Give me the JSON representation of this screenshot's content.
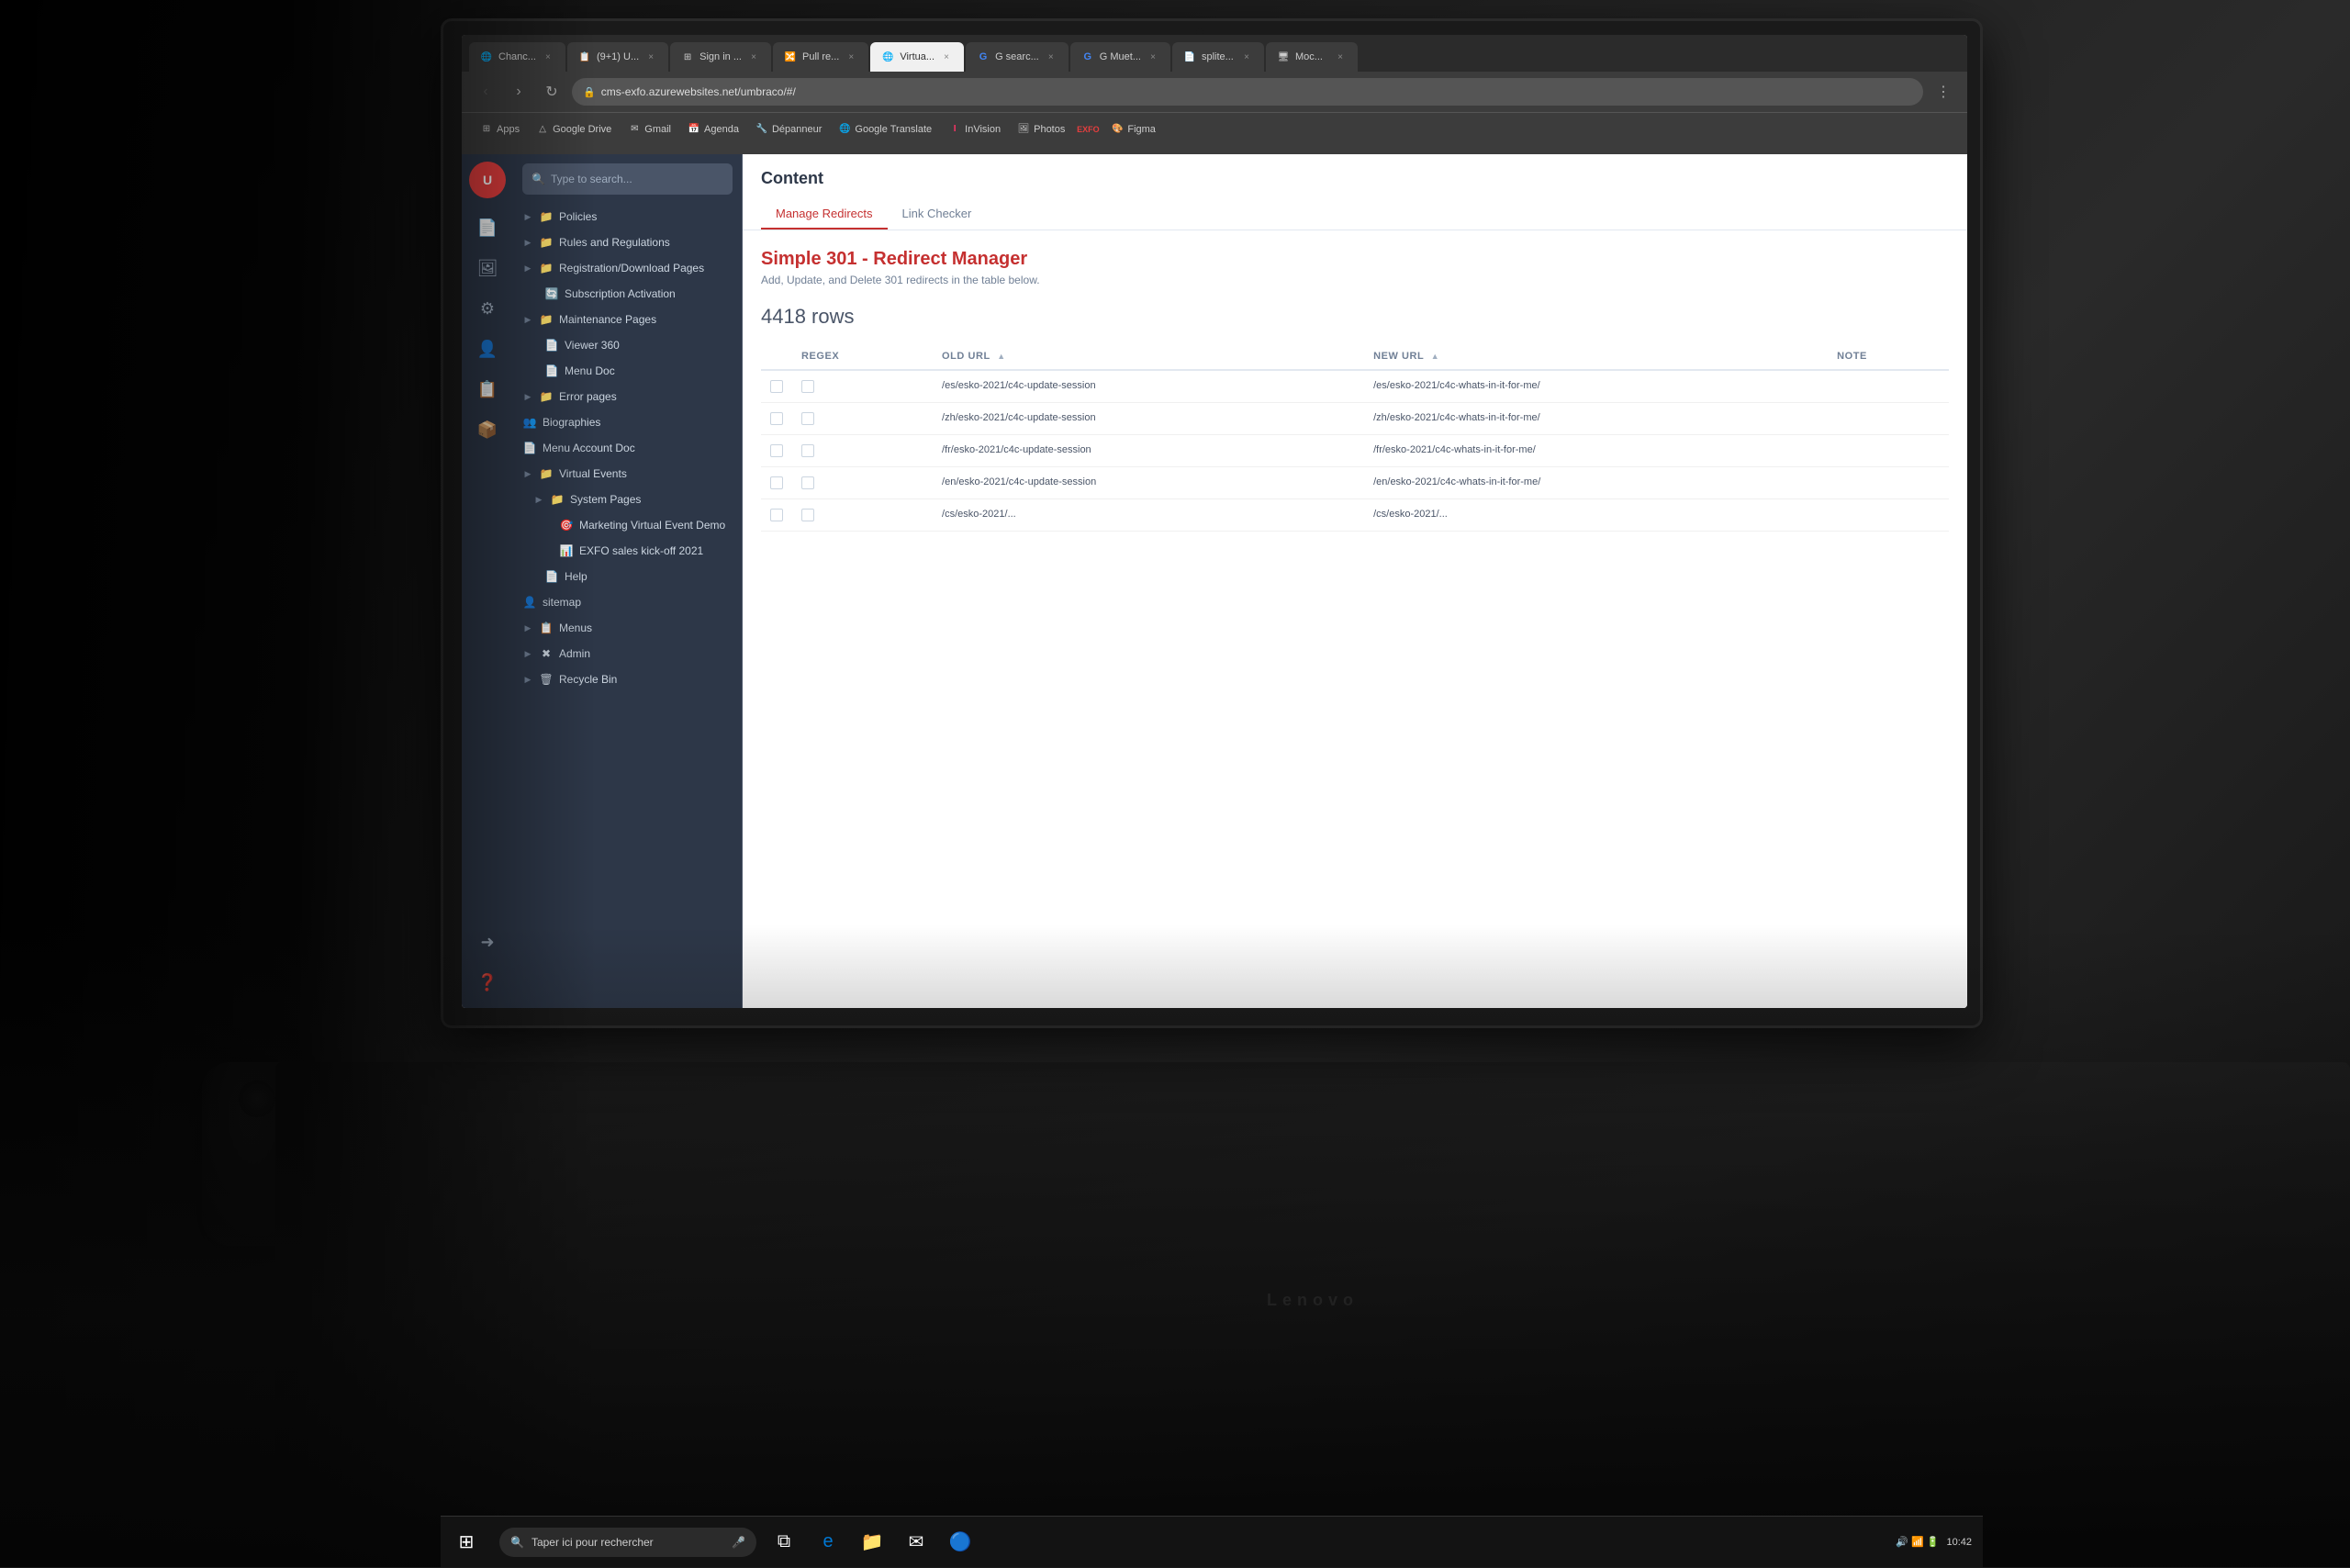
{
  "browser": {
    "tabs": [
      {
        "label": "Chanc...",
        "active": false,
        "favicon": "🌐"
      },
      {
        "label": "(9+1) U...",
        "active": false,
        "favicon": "📋"
      },
      {
        "label": "Sign in ...",
        "active": false,
        "favicon": "⊞"
      },
      {
        "label": "Pull re...",
        "active": false,
        "favicon": "🔀"
      },
      {
        "label": "Virtua...",
        "active": true,
        "favicon": "🌐"
      },
      {
        "label": "G searc...",
        "active": false,
        "favicon": "G"
      },
      {
        "label": "G Muet...",
        "active": false,
        "favicon": "G"
      },
      {
        "label": "splite...",
        "active": false,
        "favicon": "📄"
      },
      {
        "label": "Moc...",
        "active": false,
        "favicon": "🖥"
      }
    ],
    "address": "cms-exfo.azurewebsites.net/umbraco/#/",
    "bookmarks": [
      "Apps",
      "Google Drive",
      "Gmail",
      "Agenda",
      "Dépanneur",
      "Google Translate",
      "InVision",
      "Photos",
      "EXFO",
      "Figma"
    ]
  },
  "cms": {
    "search_placeholder": "Type to search...",
    "tree_items": [
      {
        "label": "Policies",
        "level": 0,
        "icon": "📁",
        "has_children": true
      },
      {
        "label": "Rules and Regulations",
        "level": 0,
        "icon": "📁",
        "has_children": true
      },
      {
        "label": "Registration/Download Pages",
        "level": 0,
        "icon": "📁",
        "has_children": true
      },
      {
        "label": "Subscription Activation",
        "level": 1,
        "icon": "🔄",
        "has_children": false
      },
      {
        "label": "Maintenance Pages",
        "level": 0,
        "icon": "📁",
        "has_children": true
      },
      {
        "label": "Viewer 360",
        "level": 1,
        "icon": "📄",
        "has_children": false
      },
      {
        "label": "Menu Doc",
        "level": 1,
        "icon": "📄",
        "has_children": false
      },
      {
        "label": "Error pages",
        "level": 0,
        "icon": "📁",
        "has_children": true
      },
      {
        "label": "Biographies",
        "level": 0,
        "icon": "👥",
        "has_children": false
      },
      {
        "label": "Menu Account Doc",
        "level": 0,
        "icon": "📄",
        "has_children": false
      },
      {
        "label": "Virtual Events",
        "level": 0,
        "icon": "📁",
        "has_children": true
      },
      {
        "label": "System Pages",
        "level": 1,
        "icon": "📁",
        "has_children": true
      },
      {
        "label": "Marketing Virtual Event Demo",
        "level": 2,
        "icon": "🎯",
        "has_children": false
      },
      {
        "label": "EXFO sales kick-off 2021",
        "level": 2,
        "icon": "📊",
        "has_children": false
      },
      {
        "label": "Help",
        "level": 1,
        "icon": "📄",
        "has_children": false
      },
      {
        "label": "sitemap",
        "level": 0,
        "icon": "👤",
        "has_children": false
      },
      {
        "label": "Menus",
        "level": 0,
        "icon": "📋",
        "has_children": true
      },
      {
        "label": "Admin",
        "level": 0,
        "icon": "✖",
        "has_children": true
      },
      {
        "label": "Recycle Bin",
        "level": 0,
        "icon": "🗑",
        "has_children": true
      }
    ]
  },
  "content": {
    "title": "Content",
    "tabs": [
      {
        "label": "Manage Redirects",
        "active": true
      },
      {
        "label": "Link Checker",
        "active": false
      }
    ],
    "redirect_manager": {
      "title": "Simple 301 - Redirect Manager",
      "subtitle": "Add, Update, and Delete 301 redirects in the table below.",
      "rows_count": "4418 rows",
      "table_headers": [
        {
          "label": "REGEX"
        },
        {
          "label": "OLD URL"
        },
        {
          "label": "NEW URL"
        },
        {
          "label": "NOTE"
        }
      ],
      "rows": [
        {
          "regex": false,
          "old_url": "/es/esko-2021/c4c-update-session",
          "new_url": "/es/esko-2021/c4c-whats-in-it-for-me/",
          "note": ""
        },
        {
          "regex": false,
          "old_url": "/zh/esko-2021/c4c-update-session",
          "new_url": "/zh/esko-2021/c4c-whats-in-it-for-me/",
          "note": ""
        },
        {
          "regex": false,
          "old_url": "/fr/esko-2021/c4c-update-session",
          "new_url": "/fr/esko-2021/c4c-whats-in-it-for-me/",
          "note": ""
        },
        {
          "regex": false,
          "old_url": "/en/esko-2021/c4c-update-session",
          "new_url": "/en/esko-2021/c4c-whats-in-it-for-me/",
          "note": ""
        },
        {
          "regex": false,
          "old_url": "/cs/esko-2021/...",
          "new_url": "/cs/esko-2021/...",
          "note": ""
        }
      ]
    }
  },
  "taskbar": {
    "search_placeholder": "Taper ici pour rechercher",
    "icons": [
      "🪟",
      "🌐",
      "📁",
      "📧",
      "🔵"
    ]
  }
}
